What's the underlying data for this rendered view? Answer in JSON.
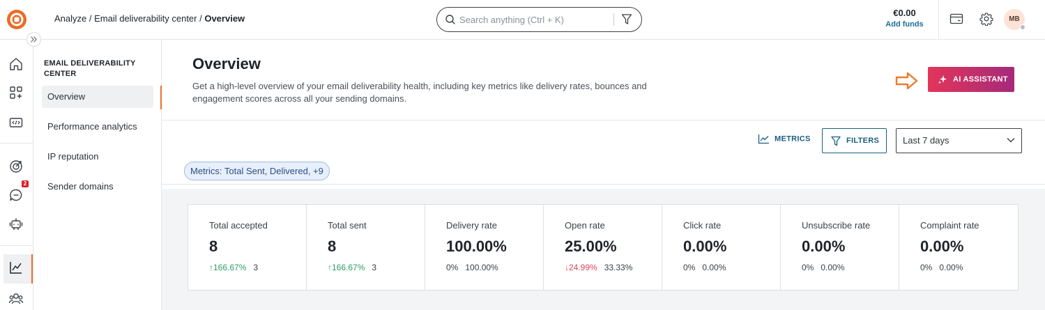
{
  "topbar": {
    "breadcrumb": {
      "part1": "Analyze",
      "sep": " / ",
      "part2": "Email deliverability center",
      "current": "Overview"
    },
    "search": {
      "placeholder": "Search anything (Ctrl + K)"
    },
    "funds": {
      "amount": "€0.00",
      "add_label": "Add funds"
    },
    "avatar": {
      "initials": "MB"
    }
  },
  "rail": {
    "notification_count": "2"
  },
  "subnav": {
    "heading": "EMAIL DELIVERABILITY CENTER",
    "items": [
      {
        "label": "Overview",
        "active": true
      },
      {
        "label": "Performance analytics",
        "active": false
      },
      {
        "label": "IP reputation",
        "active": false
      },
      {
        "label": "Sender domains",
        "active": false
      }
    ]
  },
  "main": {
    "title": "Overview",
    "description": "Get a high-level overview of your email deliverability health, including key metrics like delivery rates, bounces and engagement scores across all your sending domains.",
    "ai_button_label": "AI ASSISTANT",
    "metrics_label": "METRICS",
    "filters_label": "FILTERS",
    "range_selected": "Last 7 days",
    "chip_label": "Metrics: Total Sent, Delivered, +9",
    "cards": [
      {
        "label": "Total accepted",
        "value": "8",
        "change": "↑166.67%",
        "trend": "up",
        "previous": "3"
      },
      {
        "label": "Total sent",
        "value": "8",
        "change": "↑166.67%",
        "trend": "up",
        "previous": "3"
      },
      {
        "label": "Delivery rate",
        "value": "100.00%",
        "change": "0%",
        "trend": "neutral",
        "previous": "100.00%"
      },
      {
        "label": "Open rate",
        "value": "25.00%",
        "change": "↓24.99%",
        "trend": "down",
        "previous": "33.33%"
      },
      {
        "label": "Click rate",
        "value": "0.00%",
        "change": "0%",
        "trend": "neutral",
        "previous": "0.00%"
      },
      {
        "label": "Unsubscribe rate",
        "value": "0.00%",
        "change": "0%",
        "trend": "neutral",
        "previous": "0.00%"
      },
      {
        "label": "Complaint rate",
        "value": "0.00%",
        "change": "0%",
        "trend": "neutral",
        "previous": "0.00%"
      }
    ]
  },
  "colors": {
    "accent": "#e8702a",
    "link": "#1a5d80",
    "ai_gradient_start": "#e2355a",
    "ai_gradient_end": "#a62a7a"
  }
}
